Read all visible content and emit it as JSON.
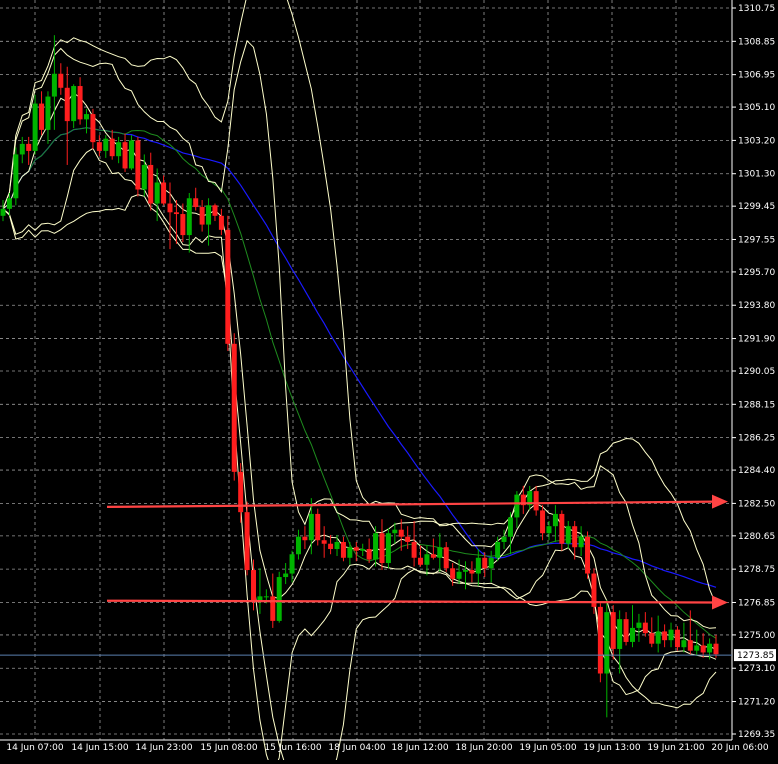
{
  "chart_data": {
    "type": "candlestick",
    "colors": {
      "background": "#000000",
      "grid": "#9a9a9a",
      "axis_text": "#ffffff",
      "bull": "#00b400",
      "bear": "#ff1e1e",
      "wick": "#c8c8c8",
      "ma_blue": "#1a1aff",
      "ma_green": "#1e8c1e",
      "bands": "#ffffcc",
      "arrow": "#ff4444",
      "price_line": "#5a7fb0",
      "price_label_bg": "#ffffff",
      "price_label_fg": "#000000"
    },
    "y_axis_ticks": [
      "1310.75",
      "1308.85",
      "1306.95",
      "1305.10",
      "1303.20",
      "1301.30",
      "1299.45",
      "1297.55",
      "1295.70",
      "1293.80",
      "1291.90",
      "1290.05",
      "1288.15",
      "1286.25",
      "1284.40",
      "1282.50",
      "1280.65",
      "1278.75",
      "1276.85",
      "1275.00",
      "1273.10",
      "1271.20",
      "1269.35"
    ],
    "x_axis_ticks": [
      "14 Jun 07:00",
      "14 Jun 15:00",
      "14 Jun 23:00",
      "15 Jun 08:00",
      "15 Jun 16:00",
      "18 Jun 04:00",
      "18 Jun 12:00",
      "18 Jun 20:00",
      "19 Jun 05:00",
      "19 Jun 13:00",
      "19 Jun 21:00",
      "20 Jun 06:00"
    ],
    "ylim": [
      1269.35,
      1310.75
    ],
    "current_price": "1273.85",
    "grid": true,
    "candles": [
      [
        1298.9,
        1299.8,
        1298.6,
        1299.3
      ],
      [
        1299.3,
        1300.2,
        1298.9,
        1299.9
      ],
      [
        1299.9,
        1302.8,
        1299.5,
        1302.4
      ],
      [
        1302.4,
        1303.4,
        1301.9,
        1303.0
      ],
      [
        1303.0,
        1303.4,
        1301.8,
        1302.6
      ],
      [
        1302.6,
        1305.8,
        1302.4,
        1305.3
      ],
      [
        1305.3,
        1306.0,
        1303.5,
        1303.8
      ],
      [
        1303.8,
        1306.0,
        1303.0,
        1305.7
      ],
      [
        1305.7,
        1309.2,
        1303.8,
        1307.0
      ],
      [
        1307.0,
        1307.6,
        1305.8,
        1306.2
      ],
      [
        1306.2,
        1307.4,
        1301.8,
        1304.3
      ],
      [
        1304.3,
        1306.4,
        1303.9,
        1306.3
      ],
      [
        1306.3,
        1306.8,
        1304.1,
        1304.4
      ],
      [
        1304.4,
        1305.0,
        1303.6,
        1304.7
      ],
      [
        1304.7,
        1305.0,
        1302.7,
        1303.1
      ],
      [
        1303.1,
        1303.5,
        1302.3,
        1302.6
      ],
      [
        1302.6,
        1303.5,
        1302.2,
        1303.3
      ],
      [
        1303.3,
        1303.8,
        1302.1,
        1302.3
      ],
      [
        1302.3,
        1303.4,
        1301.9,
        1303.1
      ],
      [
        1303.1,
        1303.6,
        1301.4,
        1301.6
      ],
      [
        1301.6,
        1303.5,
        1301.5,
        1303.2
      ],
      [
        1303.2,
        1303.4,
        1300.0,
        1300.4
      ],
      [
        1300.4,
        1302.4,
        1300.0,
        1301.8
      ],
      [
        1301.8,
        1302.5,
        1299.2,
        1299.6
      ],
      [
        1299.6,
        1301.6,
        1298.6,
        1300.8
      ],
      [
        1300.8,
        1301.2,
        1299.5,
        1299.6
      ],
      [
        1299.6,
        1300.8,
        1297.0,
        1299.1
      ],
      [
        1299.1,
        1299.8,
        1297.3,
        1299.0
      ],
      [
        1299.0,
        1299.6,
        1297.4,
        1297.8
      ],
      [
        1297.8,
        1300.2,
        1296.8,
        1299.9
      ],
      [
        1299.9,
        1300.5,
        1299.2,
        1299.4
      ],
      [
        1299.4,
        1299.8,
        1298.0,
        1298.4
      ],
      [
        1298.4,
        1299.9,
        1297.2,
        1299.5
      ],
      [
        1299.5,
        1299.6,
        1298.6,
        1298.9
      ],
      [
        1298.9,
        1299.3,
        1297.8,
        1298.1
      ],
      [
        1298.1,
        1298.9,
        1291.2,
        1291.6
      ],
      [
        1291.6,
        1292.2,
        1283.8,
        1284.3
      ],
      [
        1284.3,
        1284.8,
        1281.4,
        1282.0
      ],
      [
        1282.0,
        1282.6,
        1278.4,
        1278.7
      ],
      [
        1278.7,
        1279.3,
        1276.4,
        1276.9
      ],
      [
        1276.9,
        1278.8,
        1276.2,
        1277.2
      ],
      [
        1277.2,
        1277.6,
        1276.8,
        1277.2
      ],
      [
        1277.2,
        1278.5,
        1275.4,
        1275.8
      ],
      [
        1275.8,
        1278.6,
        1275.7,
        1278.3
      ],
      [
        1278.3,
        1279.1,
        1277.9,
        1278.5
      ],
      [
        1278.5,
        1279.8,
        1278.0,
        1279.6
      ],
      [
        1279.6,
        1281.0,
        1279.3,
        1280.6
      ],
      [
        1280.6,
        1281.2,
        1279.9,
        1280.4
      ],
      [
        1280.4,
        1282.8,
        1279.6,
        1281.9
      ],
      [
        1281.9,
        1282.2,
        1280.1,
        1280.4
      ],
      [
        1280.4,
        1281.2,
        1279.4,
        1280.2
      ],
      [
        1280.2,
        1280.7,
        1279.6,
        1279.9
      ],
      [
        1279.9,
        1280.7,
        1279.5,
        1280.3
      ],
      [
        1280.3,
        1280.6,
        1279.2,
        1279.4
      ],
      [
        1279.4,
        1280.3,
        1279.0,
        1280.0
      ],
      [
        1280.0,
        1280.3,
        1279.2,
        1279.8
      ],
      [
        1279.8,
        1280.2,
        1279.5,
        1279.9
      ],
      [
        1279.9,
        1280.5,
        1279.1,
        1279.3
      ],
      [
        1279.3,
        1281.2,
        1278.9,
        1280.8
      ],
      [
        1280.8,
        1281.6,
        1278.7,
        1279.1
      ],
      [
        1279.1,
        1281.1,
        1278.8,
        1280.8
      ],
      [
        1280.8,
        1281.4,
        1280.2,
        1281.0
      ],
      [
        1281.0,
        1281.6,
        1279.8,
        1280.6
      ],
      [
        1280.6,
        1281.2,
        1279.9,
        1280.3
      ],
      [
        1280.3,
        1281.5,
        1278.9,
        1279.4
      ],
      [
        1279.4,
        1280.1,
        1278.9,
        1279.0
      ],
      [
        1279.0,
        1280.1,
        1278.4,
        1279.6
      ],
      [
        1279.6,
        1280.5,
        1279.3,
        1279.4
      ],
      [
        1279.4,
        1280.8,
        1278.6,
        1280.0
      ],
      [
        1280.0,
        1280.3,
        1278.6,
        1278.8
      ],
      [
        1278.8,
        1279.1,
        1277.8,
        1278.2
      ],
      [
        1278.2,
        1279.3,
        1277.9,
        1278.6
      ],
      [
        1278.6,
        1279.2,
        1277.6,
        1278.7
      ],
      [
        1278.7,
        1279.2,
        1278.0,
        1278.5
      ],
      [
        1278.5,
        1279.9,
        1277.8,
        1279.4
      ],
      [
        1279.4,
        1279.7,
        1278.3,
        1278.8
      ],
      [
        1278.8,
        1279.8,
        1278.0,
        1279.4
      ],
      [
        1279.4,
        1280.6,
        1279.2,
        1280.3
      ],
      [
        1280.3,
        1281.0,
        1279.9,
        1280.6
      ],
      [
        1280.6,
        1282.0,
        1279.6,
        1281.7
      ],
      [
        1281.7,
        1283.2,
        1281.1,
        1283.0
      ],
      [
        1283.0,
        1283.5,
        1281.9,
        1282.4
      ],
      [
        1282.4,
        1283.5,
        1282.1,
        1283.2
      ],
      [
        1283.2,
        1283.5,
        1281.8,
        1282.1
      ],
      [
        1282.1,
        1282.4,
        1280.4,
        1280.8
      ],
      [
        1280.8,
        1281.5,
        1280.4,
        1281.2
      ],
      [
        1281.2,
        1282.4,
        1280.3,
        1281.9
      ],
      [
        1281.9,
        1282.1,
        1279.8,
        1280.2
      ],
      [
        1280.2,
        1281.5,
        1279.9,
        1281.2
      ],
      [
        1281.2,
        1281.5,
        1279.3,
        1280.0
      ],
      [
        1280.0,
        1281.2,
        1279.5,
        1280.6
      ],
      [
        1280.6,
        1280.9,
        1278.2,
        1278.5
      ],
      [
        1278.5,
        1278.8,
        1276.2,
        1276.6
      ],
      [
        1276.6,
        1276.8,
        1272.3,
        1272.8
      ],
      [
        1272.8,
        1277.0,
        1270.3,
        1276.3
      ],
      [
        1276.3,
        1276.7,
        1273.6,
        1274.2
      ],
      [
        1274.2,
        1276.4,
        1272.8,
        1275.9
      ],
      [
        1275.9,
        1276.3,
        1274.4,
        1274.6
      ],
      [
        1274.6,
        1276.7,
        1274.3,
        1275.4
      ],
      [
        1275.4,
        1276.2,
        1274.6,
        1275.7
      ],
      [
        1275.7,
        1276.3,
        1274.9,
        1275.1
      ],
      [
        1275.1,
        1276.0,
        1274.3,
        1274.5
      ],
      [
        1274.5,
        1276.1,
        1274.0,
        1275.2
      ],
      [
        1275.2,
        1275.6,
        1274.3,
        1274.7
      ],
      [
        1274.7,
        1275.7,
        1274.3,
        1275.3
      ],
      [
        1275.3,
        1275.5,
        1274.1,
        1274.3
      ],
      [
        1274.3,
        1275.7,
        1274.0,
        1274.7
      ],
      [
        1274.7,
        1276.4,
        1273.9,
        1274.1
      ],
      [
        1274.1,
        1275.3,
        1273.8,
        1274.4
      ],
      [
        1274.4,
        1275.1,
        1273.7,
        1274.0
      ],
      [
        1274.0,
        1274.8,
        1273.6,
        1274.5
      ],
      [
        1274.5,
        1275.0,
        1273.7,
        1273.9
      ]
    ],
    "horizontal_arrows": [
      {
        "level_start": 1282.3,
        "level_end": 1282.6
      },
      {
        "level_start": 1276.95,
        "level_end": 1276.85
      }
    ]
  }
}
